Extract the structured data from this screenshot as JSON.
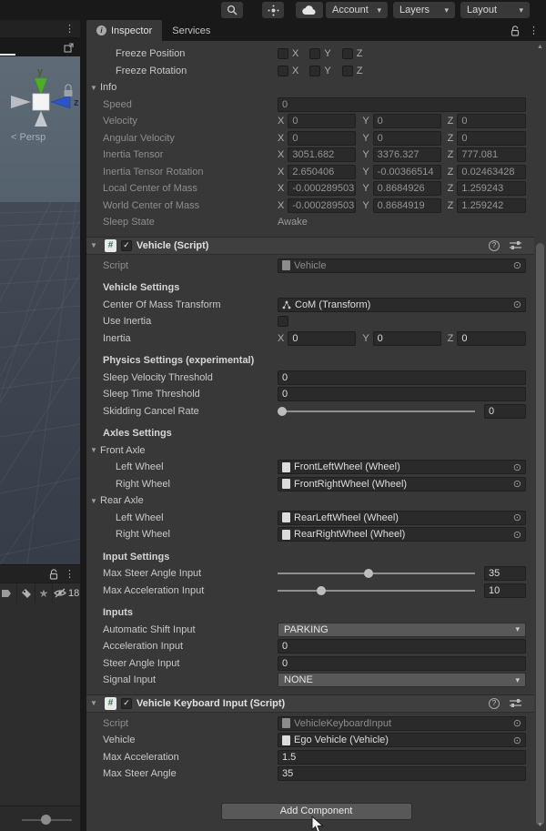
{
  "toolbar": {
    "account_label": "Account",
    "layers_label": "Layers",
    "layout_label": "Layout"
  },
  "scene": {
    "persp_label": "< Persp",
    "axis_y_label": "y",
    "axis_z_label": "z",
    "hidden_count": "18"
  },
  "icons": {
    "foldout": "▼",
    "menu": "⋮",
    "check": "✓",
    "picker": "⊙",
    "dropdown": "▾",
    "star": "★",
    "help": "?",
    "info": "i",
    "hash": "#",
    "scroll_up": "▲",
    "scroll_down": "▼"
  },
  "inspector": {
    "tab_inspector": "Inspector",
    "tab_services": "Services",
    "axis": {
      "x": "X",
      "y": "Y",
      "z": "Z"
    },
    "rigidbody": {
      "freeze_position_label": "Freeze Position",
      "freeze_rotation_label": "Freeze Rotation",
      "info_label": "Info",
      "speed": {
        "label": "Speed",
        "value": "0"
      },
      "velocity": {
        "label": "Velocity",
        "x": "0",
        "y": "0",
        "z": "0"
      },
      "angular_velocity": {
        "label": "Angular Velocity",
        "x": "0",
        "y": "0",
        "z": "0"
      },
      "inertia_tensor": {
        "label": "Inertia Tensor",
        "x": "3051.682",
        "y": "3376.327",
        "z": "777.081"
      },
      "inertia_tensor_rotation": {
        "label": "Inertia Tensor Rotation",
        "x": "2.650406",
        "y": "-0.00366514",
        "z": "0.02463428"
      },
      "local_center_of_mass": {
        "label": "Local Center of Mass",
        "x": "-0.000289503",
        "y": "0.8684926",
        "z": "1.259243"
      },
      "world_center_of_mass": {
        "label": "World Center of Mass",
        "x": "-0.000289503",
        "y": "0.8684919",
        "z": "1.259242"
      },
      "sleep_state": {
        "label": "Sleep State",
        "value": "Awake"
      }
    },
    "vehicle_component": {
      "title": "Vehicle (Script)",
      "script": {
        "label": "Script",
        "value": "Vehicle"
      },
      "section_vehicle_settings": "Vehicle Settings",
      "center_of_mass_transform": {
        "label": "Center Of Mass Transform",
        "value": "CoM (Transform)"
      },
      "use_inertia_label": "Use Inertia",
      "inertia": {
        "label": "Inertia",
        "x": "0",
        "y": "0",
        "z": "0"
      },
      "section_physics": "Physics Settings (experimental)",
      "sleep_velocity_threshold": {
        "label": "Sleep Velocity Threshold",
        "value": "0"
      },
      "sleep_time_threshold": {
        "label": "Sleep Time Threshold",
        "value": "0"
      },
      "skidding_cancel_rate": {
        "label": "Skidding Cancel Rate",
        "value": "0"
      },
      "section_axles": "Axles Settings",
      "front_axle_label": "Front Axle",
      "front_left_wheel": {
        "label": "Left Wheel",
        "value": "FrontLeftWheel (Wheel)"
      },
      "front_right_wheel": {
        "label": "Right Wheel",
        "value": "FrontRightWheel (Wheel)"
      },
      "rear_axle_label": "Rear Axle",
      "rear_left_wheel": {
        "label": "Left Wheel",
        "value": "RearLeftWheel (Wheel)"
      },
      "rear_right_wheel": {
        "label": "Right Wheel",
        "value": "RearRightWheel (Wheel)"
      },
      "section_input_settings": "Input Settings",
      "max_steer_angle_input": {
        "label": "Max Steer Angle Input",
        "value": "35"
      },
      "max_acceleration_input": {
        "label": "Max Acceleration Input",
        "value": "10"
      },
      "section_inputs": "Inputs",
      "automatic_shift_input": {
        "label": "Automatic Shift Input",
        "value": "PARKING"
      },
      "acceleration_input": {
        "label": "Acceleration Input",
        "value": "0"
      },
      "steer_angle_input": {
        "label": "Steer Angle Input",
        "value": "0"
      },
      "signal_input": {
        "label": "Signal Input",
        "value": "NONE"
      }
    },
    "keyboard_component": {
      "title": "Vehicle Keyboard Input (Script)",
      "script": {
        "label": "Script",
        "value": "VehicleKeyboardInput"
      },
      "vehicle": {
        "label": "Vehicle",
        "value": "Ego Vehicle (Vehicle)"
      },
      "max_acceleration": {
        "label": "Max Acceleration",
        "value": "1.5"
      },
      "max_steer_angle": {
        "label": "Max Steer Angle",
        "value": "35"
      }
    },
    "add_component_label": "Add Component"
  }
}
